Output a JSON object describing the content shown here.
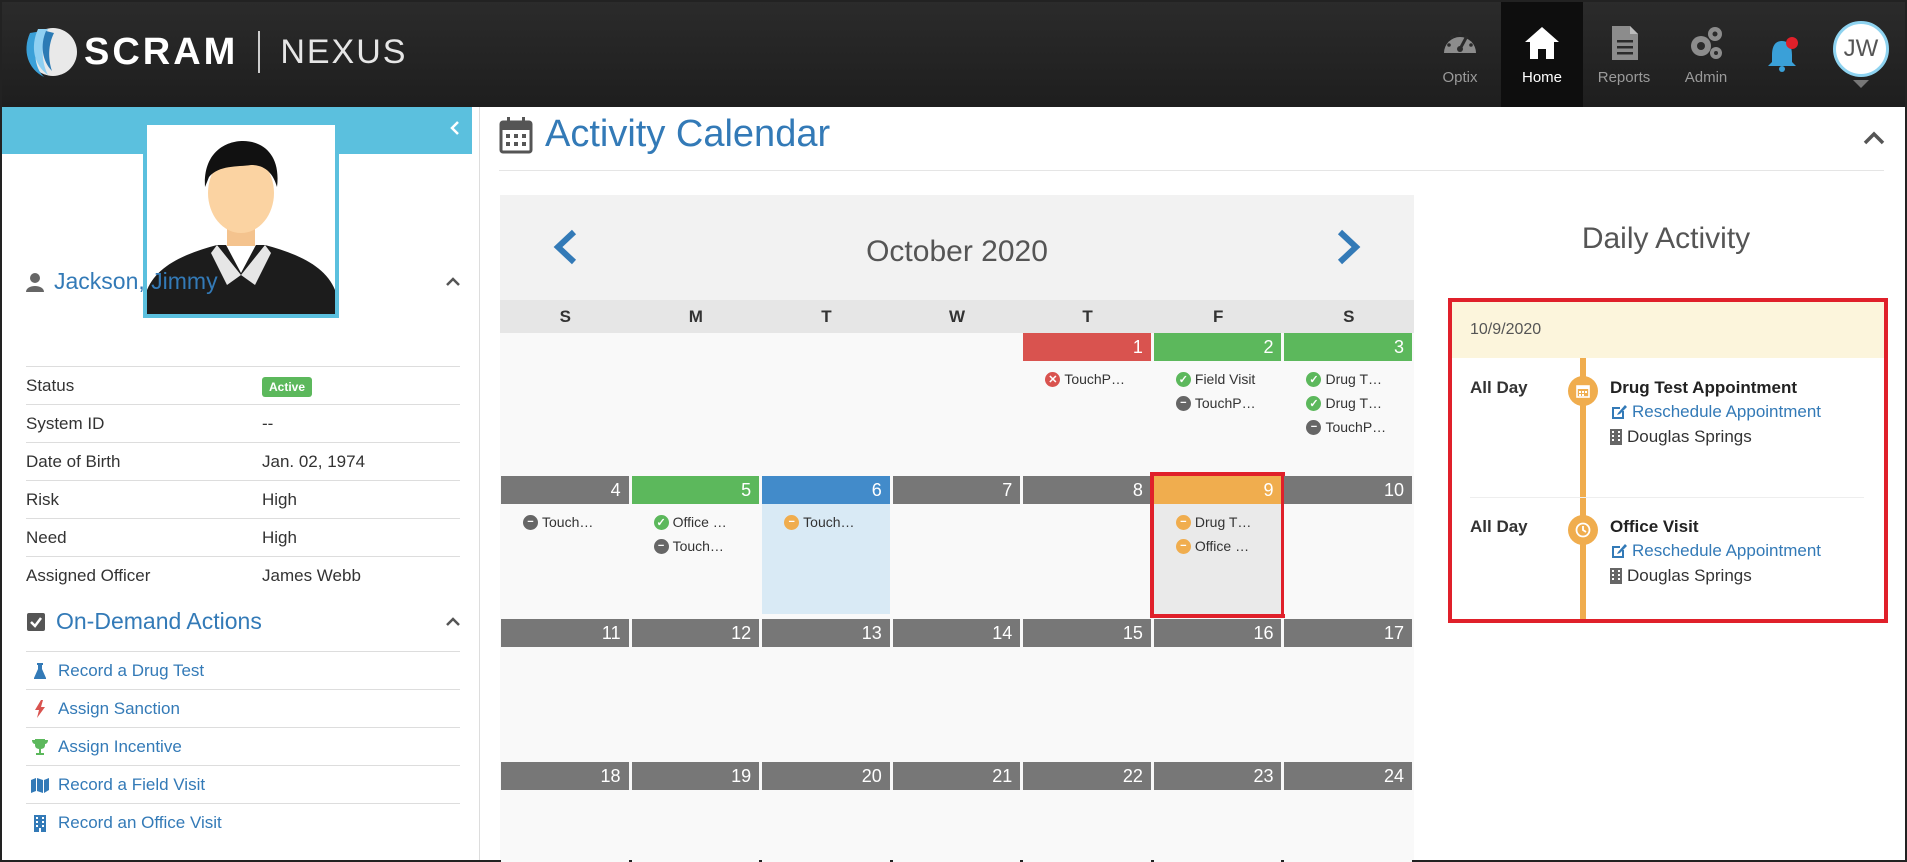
{
  "header": {
    "logo_primary": "SCRAM",
    "logo_secondary": "NEXUS",
    "nav": [
      {
        "label": "Optix",
        "icon": "gauge-icon"
      },
      {
        "label": "Home",
        "icon": "home-icon",
        "active": true
      },
      {
        "label": "Reports",
        "icon": "document-icon"
      },
      {
        "label": "Admin",
        "icon": "gears-icon"
      }
    ],
    "notifications_icon": "bell-icon",
    "user_initials": "JW"
  },
  "client": {
    "name": "Jackson, Jimmy",
    "fields": [
      {
        "label": "Status",
        "value": "Active",
        "badge": true
      },
      {
        "label": "System ID",
        "value": "--"
      },
      {
        "label": "Date of Birth",
        "value": "Jan. 02, 1974"
      },
      {
        "label": "Risk",
        "value": "High"
      },
      {
        "label": "Need",
        "value": "High"
      },
      {
        "label": "Assigned Officer",
        "value": "James Webb",
        "link": true
      }
    ]
  },
  "on_demand": {
    "title": "On-Demand Actions",
    "actions": [
      {
        "label": "Record a Drug Test",
        "icon": "flask-icon"
      },
      {
        "label": "Assign Sanction",
        "icon": "bolt-icon"
      },
      {
        "label": "Assign Incentive",
        "icon": "trophy-icon"
      },
      {
        "label": "Record a Field Visit",
        "icon": "map-icon"
      },
      {
        "label": "Record an Office Visit",
        "icon": "building-icon"
      }
    ]
  },
  "calendar": {
    "title": "Activity Calendar",
    "month": "October 2020",
    "weekdays": [
      "S",
      "M",
      "T",
      "W",
      "T",
      "F",
      "S"
    ],
    "weeks": [
      [
        {
          "num": "",
          "color": "empty",
          "events": []
        },
        {
          "num": "",
          "color": "empty",
          "events": []
        },
        {
          "num": "",
          "color": "empty",
          "events": []
        },
        {
          "num": "",
          "color": "empty",
          "events": []
        },
        {
          "num": "1",
          "color": "red",
          "events": [
            {
              "label": "TouchP…",
              "status": "r"
            }
          ]
        },
        {
          "num": "2",
          "color": "green",
          "events": [
            {
              "label": "Field Visit",
              "status": "g"
            },
            {
              "label": "TouchP…",
              "status": "k"
            }
          ]
        },
        {
          "num": "3",
          "color": "green",
          "events": [
            {
              "label": "Drug T…",
              "status": "g"
            },
            {
              "label": "Drug T…",
              "status": "g"
            },
            {
              "label": "TouchP…",
              "status": "k"
            }
          ]
        }
      ],
      [
        {
          "num": "4",
          "color": "grey",
          "events": [
            {
              "label": "Touch…",
              "status": "k"
            }
          ]
        },
        {
          "num": "5",
          "color": "green",
          "events": [
            {
              "label": "Office …",
              "status": "g"
            },
            {
              "label": "Touch…",
              "status": "k"
            }
          ]
        },
        {
          "num": "6",
          "color": "blue",
          "body": "light-blue",
          "events": [
            {
              "label": "Touch…",
              "status": "o"
            }
          ]
        },
        {
          "num": "7",
          "color": "grey",
          "events": []
        },
        {
          "num": "8",
          "color": "grey",
          "events": []
        },
        {
          "num": "9",
          "color": "orange",
          "body": "grey",
          "selected": true,
          "events": [
            {
              "label": "Drug T…",
              "status": "o"
            },
            {
              "label": "Office …",
              "status": "o"
            }
          ]
        },
        {
          "num": "10",
          "color": "grey",
          "events": []
        }
      ],
      [
        {
          "num": "11",
          "color": "grey",
          "events": []
        },
        {
          "num": "12",
          "color": "grey",
          "events": []
        },
        {
          "num": "13",
          "color": "grey",
          "events": []
        },
        {
          "num": "14",
          "color": "grey",
          "events": []
        },
        {
          "num": "15",
          "color": "grey",
          "events": []
        },
        {
          "num": "16",
          "color": "grey",
          "events": []
        },
        {
          "num": "17",
          "color": "grey",
          "events": []
        }
      ],
      [
        {
          "num": "18",
          "color": "grey",
          "events": []
        },
        {
          "num": "19",
          "color": "grey",
          "events": []
        },
        {
          "num": "20",
          "color": "grey",
          "events": []
        },
        {
          "num": "21",
          "color": "grey",
          "events": []
        },
        {
          "num": "22",
          "color": "grey",
          "events": []
        },
        {
          "num": "23",
          "color": "grey",
          "events": []
        },
        {
          "num": "24",
          "color": "grey",
          "events": []
        }
      ]
    ]
  },
  "daily": {
    "title": "Daily Activity",
    "date": "10/9/2020",
    "entries": [
      {
        "time": "All Day",
        "title": "Drug Test Appointment",
        "action": "Reschedule Appointment",
        "location": "Douglas Springs",
        "icon": "calendar-icon"
      },
      {
        "time": "All Day",
        "title": "Office Visit",
        "action": "Reschedule Appointment",
        "location": "Douglas Springs",
        "icon": "clock-icon"
      }
    ]
  },
  "colors": {
    "accent": "#337ab7",
    "sidebar_band": "#5bc0de",
    "status_green": "#5cb85c",
    "status_red": "#d9534f",
    "status_orange": "#f0ad4e",
    "highlight": "#e0202a"
  }
}
